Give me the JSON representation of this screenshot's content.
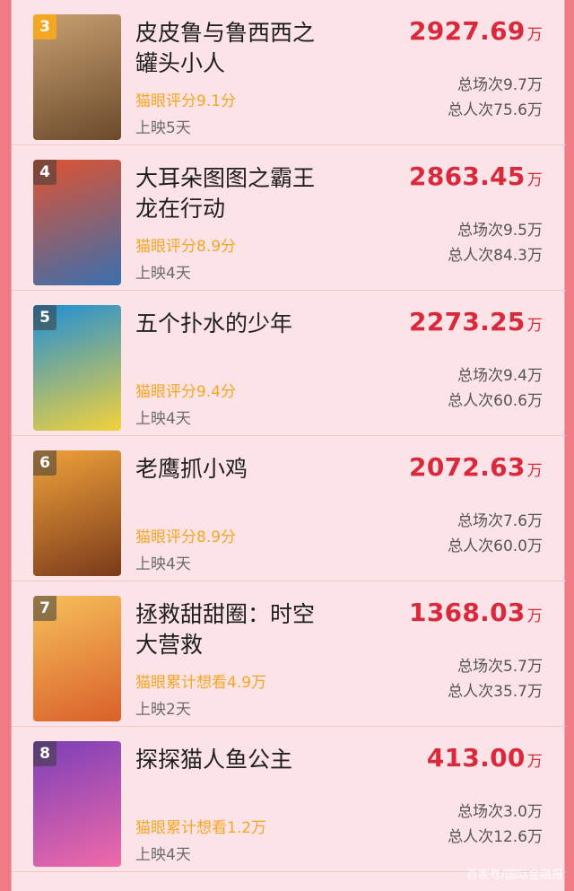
{
  "movies": [
    {
      "rank": "3",
      "title": "皮皮鲁与鲁西西之罐头小人",
      "rating": "猫眼评分9.1分",
      "days": "上映5天",
      "box_office": "2927.69",
      "unit": "万",
      "shows": "总场次9.7万",
      "people": "总人次75.6万",
      "poster_colors": [
        "#c8a070",
        "#6b4a2b"
      ]
    },
    {
      "rank": "4",
      "title": "大耳朵图图之霸王龙在行动",
      "rating": "猫眼评分8.9分",
      "days": "上映4天",
      "box_office": "2863.45",
      "unit": "万",
      "shows": "总场次9.5万",
      "people": "总人次84.3万",
      "poster_colors": [
        "#e0532f",
        "#3a6fb0"
      ]
    },
    {
      "rank": "5",
      "title": "五个扑水的少年",
      "rating": "猫眼评分9.4分",
      "days": "上映4天",
      "box_office": "2273.25",
      "unit": "万",
      "shows": "总场次9.4万",
      "people": "总人次60.6万",
      "poster_colors": [
        "#1e8ed8",
        "#f3d23a"
      ]
    },
    {
      "rank": "6",
      "title": "老鹰抓小鸡",
      "rating": "猫眼评分8.9分",
      "days": "上映4天",
      "box_office": "2072.63",
      "unit": "万",
      "shows": "总场次7.6万",
      "people": "总人次60.0万",
      "poster_colors": [
        "#f0a23a",
        "#7a3a1a"
      ]
    },
    {
      "rank": "7",
      "title": "拯救甜甜圈：时空大营救",
      "rating": "猫眼累计想看4.9万",
      "days": "上映2天",
      "box_office": "1368.03",
      "unit": "万",
      "shows": "总场次5.7万",
      "people": "总人次35.7万",
      "poster_colors": [
        "#f6c05a",
        "#d9602a"
      ]
    },
    {
      "rank": "8",
      "title": "探探猫人鱼公主",
      "rating": "猫眼累计想看1.2万",
      "days": "上映4天",
      "box_office": "413.00",
      "unit": "万",
      "shows": "总场次3.0万",
      "people": "总人次12.6万",
      "poster_colors": [
        "#7a3fb8",
        "#f06aa8"
      ]
    }
  ],
  "watermark": "百家号/国际金融报"
}
